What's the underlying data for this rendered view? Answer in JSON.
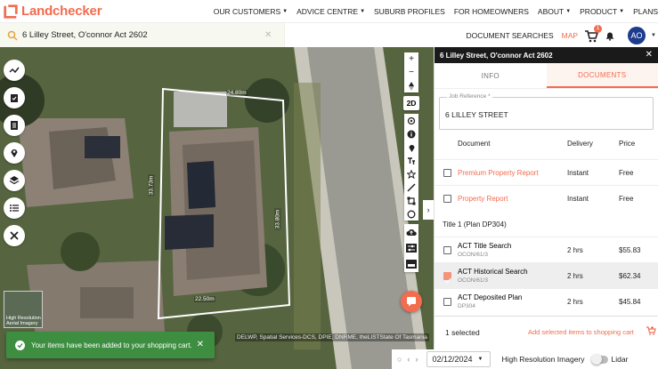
{
  "header": {
    "logo_text": "Landchecker",
    "nav": [
      {
        "label": "OUR CUSTOMERS",
        "caret": true
      },
      {
        "label": "ADVICE CENTRE",
        "caret": true
      },
      {
        "label": "SUBURB PROFILES",
        "caret": false
      },
      {
        "label": "FOR HOMEOWNERS",
        "caret": false
      },
      {
        "label": "ABOUT",
        "caret": true
      },
      {
        "label": "PRODUCT",
        "caret": true
      },
      {
        "label": "PLANS",
        "caret": false
      }
    ]
  },
  "search": {
    "value": "6 Lilley Street, O'connor Act 2602",
    "document_searches": "DOCUMENT SEARCHES",
    "map": "MAP",
    "cart_count": "1",
    "avatar_initials": "AO"
  },
  "map": {
    "dimensions": [
      "24.80m",
      "33.73m",
      "33.80m",
      "22.50m"
    ],
    "btn_2d": "2D",
    "hr_label_line1": "High Resolution",
    "hr_label_line2": "Aerial Imagery",
    "attribution": "DELWP, Spatial Services-DCS, DPIE, DNRME, theLISTState Of Tasmania"
  },
  "toast": {
    "message": "Your items have been added to your shopping cart."
  },
  "bottom_bar": {
    "date": "02/12/2024",
    "imagery_label": "High Resolution Imagery",
    "lidar_label": "Lidar"
  },
  "panel": {
    "title": "6 Lilley Street, O'connor Act 2602",
    "tabs": [
      {
        "label": "INFO",
        "active": false
      },
      {
        "label": "DOCUMENTS",
        "active": true
      }
    ],
    "job_reference_label": "Job Reference *",
    "job_reference_value": "6 LILLEY STREET",
    "columns": {
      "document": "Document",
      "delivery": "Delivery",
      "price": "Price"
    },
    "top_rows": [
      {
        "title": "Premium Property Report",
        "delivery": "Instant",
        "price": "Free",
        "checked": false
      },
      {
        "title": "Property Report",
        "delivery": "Instant",
        "price": "Free",
        "checked": false
      }
    ],
    "section_title": "Title 1 (Plan DP304)",
    "title_rows": [
      {
        "title": "ACT Title Search",
        "sub": "OCON/61/3",
        "delivery": "2 hrs",
        "price": "$55.83",
        "checked": false
      },
      {
        "title": "ACT Historical Search",
        "sub": "OCON/61/3",
        "delivery": "2 hrs",
        "price": "$62.34",
        "checked": true
      },
      {
        "title": "ACT Deposited Plan",
        "sub": "DP304",
        "delivery": "2 hrs",
        "price": "$45.84",
        "checked": false
      }
    ],
    "footer": {
      "selected": "1 selected",
      "add_label": "Add selected items to shopping cart"
    }
  },
  "colors": {
    "brand_orange": "#f26c4f",
    "toast_green": "#3e8e41",
    "avatar_blue": "#1d3c8c"
  }
}
